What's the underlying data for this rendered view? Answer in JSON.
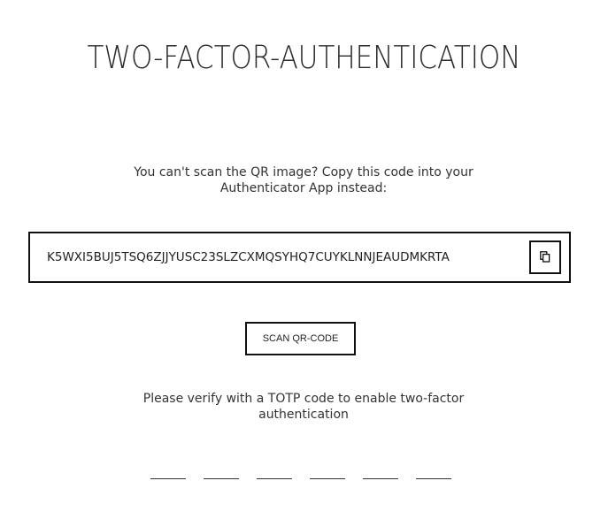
{
  "page": {
    "title": "TWO-FACTOR-AUTHENTICATION"
  },
  "setup": {
    "help_text": "You can't scan the QR image? Copy this code into your Authenticator App instead:",
    "secret_code": "K5WXI5BUJ5TSQ6ZJJYUSC23SLZCXMQSYHQ7CUYKLNNJEAUDMKRTA",
    "copy_icon": "copy-icon",
    "scan_button_label": "SCAN QR-CODE"
  },
  "verify": {
    "help_text": "Please verify with a TOTP code to enable two-factor authentication",
    "otp_fields": [
      "",
      "",
      "",
      "",
      "",
      ""
    ]
  },
  "colors": {
    "text": "#222222",
    "border": "#111111",
    "background": "#ffffff"
  }
}
